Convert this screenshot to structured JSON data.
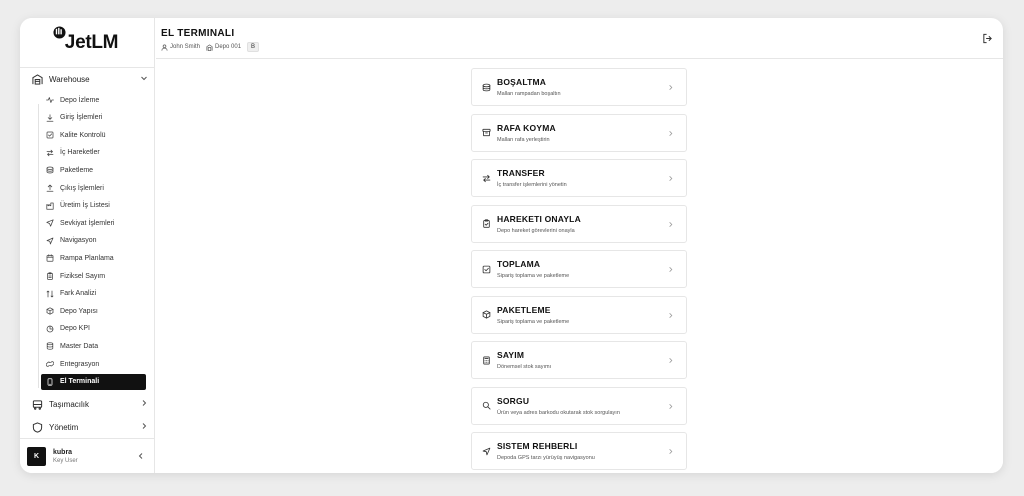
{
  "app": {
    "logo": "JetLM"
  },
  "sidebar": {
    "warehouse_label": "Warehouse",
    "items": [
      {
        "label": "Depo İzleme",
        "icon": "activity-icon"
      },
      {
        "label": "Giriş İşlemleri",
        "icon": "download-icon"
      },
      {
        "label": "Kalite Kontrolü",
        "icon": "check-square-icon"
      },
      {
        "label": "İç Hareketler",
        "icon": "arrows-icon"
      },
      {
        "label": "Paketleme",
        "icon": "package-icon"
      },
      {
        "label": "Çıkış İşlemleri",
        "icon": "upload-icon"
      },
      {
        "label": "Üretim İş Listesi",
        "icon": "factory-icon"
      },
      {
        "label": "Sevkiyat İşlemleri",
        "icon": "send-icon"
      },
      {
        "label": "Navigasyon",
        "icon": "navigation-icon"
      },
      {
        "label": "Rampa Planlama",
        "icon": "calendar-icon"
      },
      {
        "label": "Fiziksel Sayım",
        "icon": "clipboard-icon"
      },
      {
        "label": "Fark Analizi",
        "icon": "diff-icon"
      },
      {
        "label": "Depo Yapısı",
        "icon": "box-icon"
      },
      {
        "label": "Depo KPI",
        "icon": "pie-chart-icon"
      },
      {
        "label": "Master Data",
        "icon": "database-icon"
      },
      {
        "label": "Entegrasyon",
        "icon": "link-icon"
      },
      {
        "label": "El Terminali",
        "icon": "smartphone-icon"
      }
    ],
    "tasimacilik_label": "Taşımacılık",
    "yonetim_label": "Yönetim",
    "user": {
      "initial": "K",
      "name": "kubra",
      "role": "Key User"
    }
  },
  "header": {
    "title": "EL TERMINALI",
    "user": "John Smith",
    "warehouse": "Depo 001",
    "badge": "B"
  },
  "cards": [
    {
      "title": "BOŞALTMA",
      "desc": "Malları rampadan boşaltın",
      "icon": "package-icon"
    },
    {
      "title": "RAFA KOYMA",
      "desc": "Malları rafa yerleştirin",
      "icon": "archive-icon"
    },
    {
      "title": "TRANSFER",
      "desc": "İç transfer işlemlerini yönetin",
      "icon": "arrows-icon"
    },
    {
      "title": "HAREKETI ONAYLA",
      "desc": "Depo hareket görevlerini onayla",
      "icon": "clipboard-check-icon"
    },
    {
      "title": "TOPLAMA",
      "desc": "Sipariş toplama ve paketleme",
      "icon": "check-square-icon"
    },
    {
      "title": "PAKETLEME",
      "desc": "Sipariş toplama ve paketleme",
      "icon": "box-icon"
    },
    {
      "title": "SAYIM",
      "desc": "Dönemsel stok sayımı",
      "icon": "calculator-icon"
    },
    {
      "title": "SORGU",
      "desc": "Ürün veya adres barkodu okutarak stok sorgulayın",
      "icon": "search-icon"
    },
    {
      "title": "SISTEM REHBERLI",
      "desc": "Depoda GPS tarzı yürüyüş navigasyonu",
      "icon": "navigation-icon"
    }
  ]
}
